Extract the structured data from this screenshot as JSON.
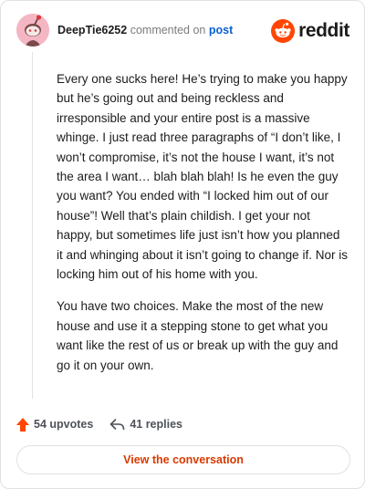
{
  "header": {
    "username": "DeepTie6252",
    "verb": "commented on",
    "target": "post",
    "brand": "reddit"
  },
  "comment": {
    "paragraphs": [
      "Every one sucks here! He’s trying to make you happy but he’s going out and being reckless and irresponsible and your entire post is a massive whinge. I just read three paragraphs of “I don’t like, I won’t compromise, it’s not the house I want, it’s not the area I want… blah blah blah! Is he even the guy you want? You ended with “I locked him out of our house”! Well that’s plain childish. I get your not happy, but sometimes life just isn’t how you planned it and whinging about it isn’t going to change if. Nor is locking him out of his home with you.",
      "You have two choices. Make the most of the new house and use it a stepping stone to get what you want like the rest of us or break up with the guy and go it on your own."
    ]
  },
  "stats": {
    "upvotes": "54 upvotes",
    "replies": "41 replies"
  },
  "actions": {
    "view_conversation": "View the conversation"
  },
  "icons": {
    "avatar": "snoo-avatar-icon",
    "logo": "reddit-logo-icon",
    "upvote": "upvote-arrow-icon",
    "reply": "reply-arrow-icon"
  },
  "colors": {
    "brand_orange": "#ff4500",
    "link_blue": "#0a60d4",
    "button_text": "#d93a00",
    "avatar_bg": "#f5b6c4"
  }
}
